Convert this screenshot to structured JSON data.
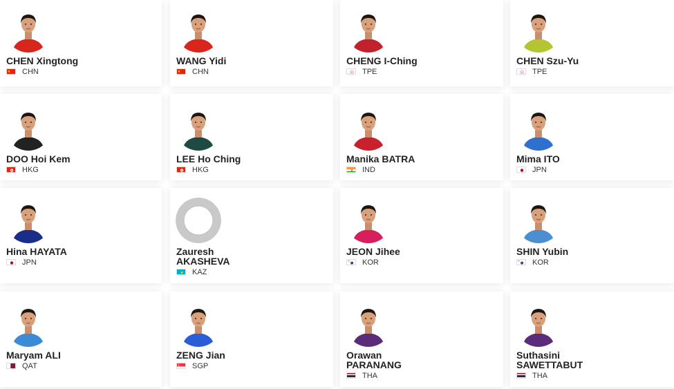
{
  "players": [
    {
      "name": [
        "CHEN Xingtong"
      ],
      "country": "CHN",
      "flag": "chn",
      "shirt": "#d8261d",
      "placeholder": false
    },
    {
      "name": [
        "WANG Yidi"
      ],
      "country": "CHN",
      "flag": "chn",
      "shirt": "#d8261d",
      "placeholder": false
    },
    {
      "name": [
        "CHENG I-Ching"
      ],
      "country": "TPE",
      "flag": "tpe",
      "shirt": "#c2222d",
      "placeholder": false
    },
    {
      "name": [
        "CHEN Szu-Yu"
      ],
      "country": "TPE",
      "flag": "tpe",
      "shirt": "#b3c530",
      "placeholder": false
    },
    {
      "name": [
        "DOO Hoi Kem"
      ],
      "country": "HKG",
      "flag": "hkg",
      "shirt": "#222222",
      "placeholder": false
    },
    {
      "name": [
        "LEE Ho Ching"
      ],
      "country": "HKG",
      "flag": "hkg",
      "shirt": "#1e4a44",
      "placeholder": false
    },
    {
      "name": [
        "Manika BATRA"
      ],
      "country": "IND",
      "flag": "ind",
      "shirt": "#c8202c",
      "placeholder": false
    },
    {
      "name": [
        "Mima ITO"
      ],
      "country": "JPN",
      "flag": "jpn",
      "shirt": "#2f6fd0",
      "placeholder": false
    },
    {
      "name": [
        "Hina HAYATA"
      ],
      "country": "JPN",
      "flag": "jpn",
      "shirt": "#1b2d8a",
      "placeholder": false
    },
    {
      "name": [
        "Zauresh",
        "AKASHEVA"
      ],
      "country": "KAZ",
      "flag": "kaz",
      "shirt": "#cccccc",
      "placeholder": true
    },
    {
      "name": [
        "JEON Jihee"
      ],
      "country": "KOR",
      "flag": "kor",
      "shirt": "#d81f5d",
      "placeholder": false
    },
    {
      "name": [
        "SHIN Yubin"
      ],
      "country": "KOR",
      "flag": "kor",
      "shirt": "#4b8fd0",
      "placeholder": false
    },
    {
      "name": [
        "Maryam ALI"
      ],
      "country": "QAT",
      "flag": "qat",
      "shirt": "#3b8bd6",
      "placeholder": false
    },
    {
      "name": [
        "ZENG Jian"
      ],
      "country": "SGP",
      "flag": "sgp",
      "shirt": "#2a5ed6",
      "placeholder": false
    },
    {
      "name": [
        "Orawan",
        "PARANANG"
      ],
      "country": "THA",
      "flag": "tha",
      "shirt": "#5a2c7a",
      "placeholder": false
    },
    {
      "name": [
        "Suthasini",
        "SAWETTABUT"
      ],
      "country": "THA",
      "flag": "tha",
      "shirt": "#5a2c7a",
      "placeholder": false
    }
  ]
}
